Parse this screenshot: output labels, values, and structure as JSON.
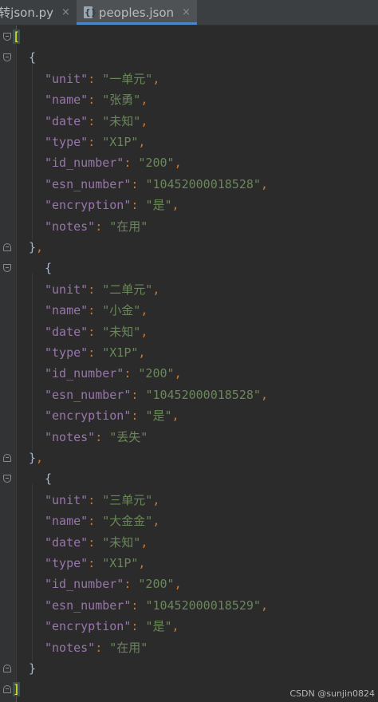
{
  "tabs": [
    {
      "label": "l转json.py",
      "close": "×"
    },
    {
      "label": "peoples.json",
      "close": "×"
    }
  ],
  "brackets": {
    "open_array": "[",
    "close_array": "]",
    "open_obj": "{",
    "close_obj": "}"
  },
  "records": [
    {
      "unit": "一单元",
      "name": "张勇",
      "date": "未知",
      "type": "X1P",
      "id_number": "200",
      "esn_number": "10452000018528",
      "encryption": "是",
      "notes": "在用"
    },
    {
      "unit": "二单元",
      "name": "小金",
      "date": "未知",
      "type": "X1P",
      "id_number": "200",
      "esn_number": "10452000018528",
      "encryption": "是",
      "notes": "丢失"
    },
    {
      "unit": "三单元",
      "name": "大金金",
      "date": "未知",
      "type": "X1P",
      "id_number": "200",
      "esn_number": "10452000018529",
      "encryption": "是",
      "notes": "在用"
    }
  ],
  "watermark": "CSDN @sunjin0824"
}
